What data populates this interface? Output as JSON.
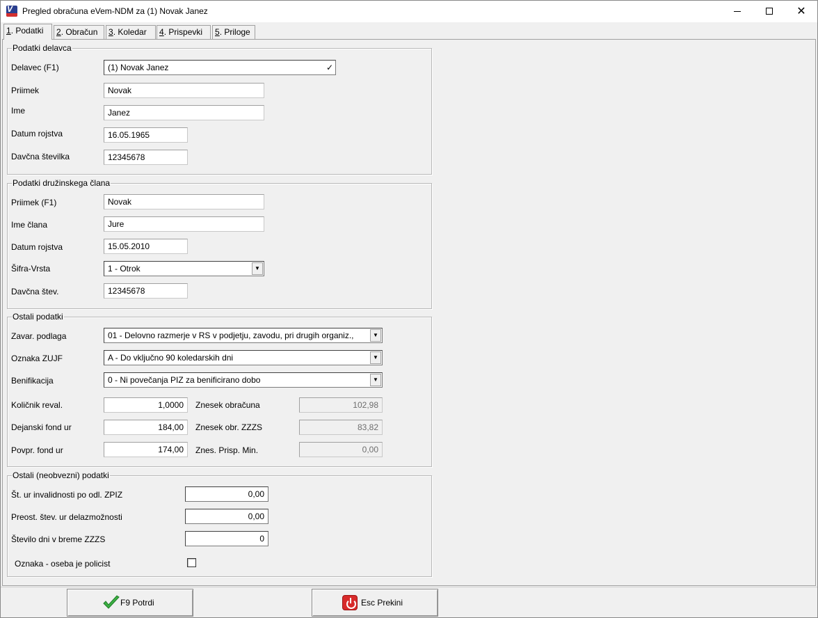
{
  "window": {
    "title": "Pregled obračuna eVem-NDM za (1) Novak Janez",
    "icon": "vasco-app-icon"
  },
  "tabs": [
    {
      "key": "1",
      "label": ". Podatki"
    },
    {
      "key": "2",
      "label": ". Obračun"
    },
    {
      "key": "3",
      "label": ". Koledar"
    },
    {
      "key": "4",
      "label": ". Prispevki"
    },
    {
      "key": "5",
      "label": ". Priloge"
    }
  ],
  "worker": {
    "group_title": "Podatki delavca",
    "delavec_label": "Delavec (F1)",
    "delavec_value": "(1) Novak Janez",
    "priimek_label": "Priimek",
    "priimek_value": "Novak",
    "ime_label": "Ime",
    "ime_value": "Janez",
    "datum_label": "Datum rojstva",
    "datum_value": "16.05.1965",
    "davcna_label": "Davčna številka",
    "davcna_value": "12345678"
  },
  "family": {
    "group_title": "Podatki družinskega člana",
    "priimek_label": "Priimek (F1)",
    "priimek_value": "Novak",
    "ime_label": "Ime člana",
    "ime_value": "Jure",
    "datum_label": "Datum rojstva",
    "datum_value": "15.05.2010",
    "sifra_label": "Šifra-Vrsta",
    "sifra_value": "1 - Otrok",
    "davcna_label": "Davčna štev.",
    "davcna_value": "12345678"
  },
  "other": {
    "group_title": "Ostali podatki",
    "zavar_label": "Zavar. podlaga",
    "zavar_value": "01 - Delovno razmerje v RS v podjetju, zavodu, pri drugih organiz.,",
    "zujf_label": "Oznaka ZUJF",
    "zujf_value": "A - Do vključno 90 koledarskih dni",
    "benif_label": "Benifikacija",
    "benif_value": "0 - Ni povečanja PIZ za benificirano dobo",
    "kolicnik_label": "Količnik reval.",
    "kolicnik_value": "1,0000",
    "dejanski_label": "Dejanski fond ur",
    "dejanski_value": "184,00",
    "povpr_label": "Povpr. fond ur",
    "povpr_value": "174,00",
    "znesek_obr_label": "Znesek obračuna",
    "znesek_obr_value": "102,98",
    "znesek_zzzs_label": "Znesek obr. ZZZS",
    "znesek_zzzs_value": "83,82",
    "znes_prisp_label": "Znes. Prisp. Min.",
    "znes_prisp_value": "0,00"
  },
  "optional": {
    "group_title": "Ostali (neobvezni) podatki",
    "invalid_label": "Št. ur invalidnosti po odl. ZPIZ",
    "invalid_value": "0,00",
    "preost_label": "Preost. štev. ur delazmožnosti",
    "preost_value": "0,00",
    "dni_label": "Število dni v breme ZZZS",
    "dni_value": "0",
    "policist_label": "Oznaka - oseba je policist",
    "policist_checked": false
  },
  "buttons": {
    "confirm_label": "F9 Potrdi",
    "cancel_label": "Esc Prekini"
  },
  "colors": {
    "confirm_icon": "#3cb043",
    "cancel_icon": "#d82a2a"
  }
}
